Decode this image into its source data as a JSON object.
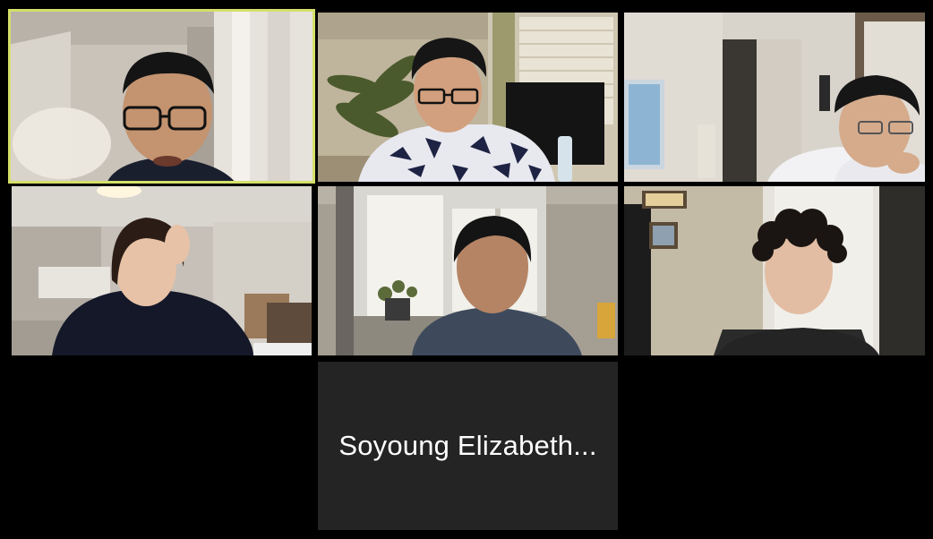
{
  "meeting": {
    "layout": "gallery-view",
    "grid": "3x3",
    "active_speaker_color": "#d4e06a",
    "background_color": "#000000"
  },
  "participants": [
    {
      "id": "p1",
      "video": "on",
      "active_speaker": true,
      "avatar_icon": "participant-video"
    },
    {
      "id": "p2",
      "video": "on",
      "active_speaker": false,
      "avatar_icon": "participant-video"
    },
    {
      "id": "p3",
      "video": "on",
      "active_speaker": false,
      "avatar_icon": "participant-video"
    },
    {
      "id": "p4",
      "video": "on",
      "active_speaker": false,
      "avatar_icon": "participant-video"
    },
    {
      "id": "p5",
      "video": "on",
      "active_speaker": false,
      "avatar_icon": "participant-video"
    },
    {
      "id": "p6",
      "video": "on",
      "active_speaker": false,
      "avatar_icon": "participant-video"
    },
    {
      "id": "p7",
      "video": "off",
      "active_speaker": false,
      "display_name": "Soyoung Elizabeth...",
      "tile_color": "#242424"
    }
  ]
}
